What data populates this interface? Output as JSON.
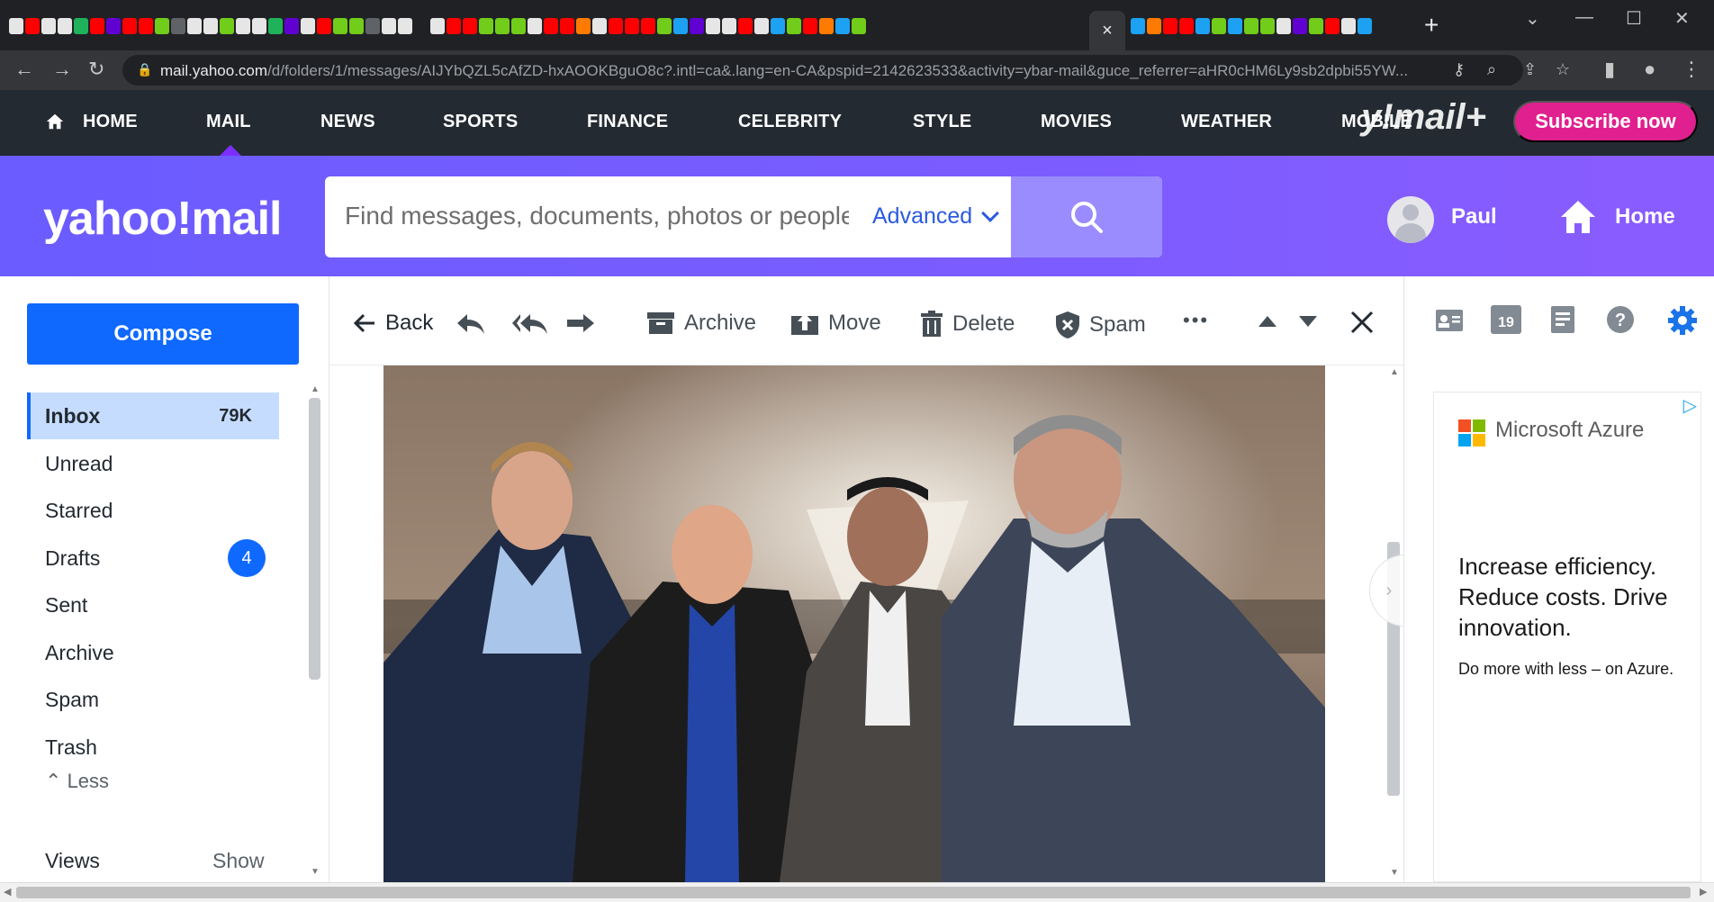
{
  "browser": {
    "active_tab_close": "×",
    "new_tab": "+",
    "url_host": "mail.yahoo.com",
    "url_path": "/d/folders/1/messages/AIJYbQZL5cAfZD-hxAOOKBguO8c?.intl=ca&.lang=en-CA&pspid=2142623533&activity=ybar-mail&guce_referrer=aHR0cHM6Ly9sb2dpbi55YW..."
  },
  "yahoo_nav": {
    "items": [
      "HOME",
      "MAIL",
      "NEWS",
      "SPORTS",
      "FINANCE",
      "CELEBRITY",
      "STYLE",
      "MOVIES",
      "WEATHER",
      "MOBILE"
    ],
    "mail_plus": "y!mail+",
    "subscribe": "Subscribe now"
  },
  "header": {
    "logo": "yahoo!mail",
    "search_placeholder": "Find messages, documents, photos or people",
    "advanced": "Advanced",
    "user_name": "Paul",
    "home": "Home"
  },
  "sidebar": {
    "compose": "Compose",
    "folders": [
      {
        "label": "Inbox",
        "count": "79K"
      },
      {
        "label": "Unread"
      },
      {
        "label": "Starred"
      },
      {
        "label": "Drafts",
        "badge": "4"
      },
      {
        "label": "Sent"
      },
      {
        "label": "Archive"
      },
      {
        "label": "Spam"
      },
      {
        "label": "Trash"
      }
    ],
    "less": "Less",
    "views": "Views",
    "views_show": "Show"
  },
  "message_toolbar": {
    "back": "Back",
    "archive": "Archive",
    "move": "Move",
    "delete": "Delete",
    "spam": "Spam",
    "more": "•••"
  },
  "right_rail": {
    "calendar_day": "19"
  },
  "ad": {
    "brand": "Microsoft Azure",
    "headline": "Increase efficiency. Reduce costs. Drive innovation.",
    "sub": "Do more with less – on Azure."
  },
  "colors": {
    "yahoo_purple": "#7b5cff",
    "nav_dark": "#232a31",
    "compose_blue": "#0f69ff",
    "subscribe_pink": "#e0208e",
    "inbox_highlight": "#c5dcff"
  }
}
